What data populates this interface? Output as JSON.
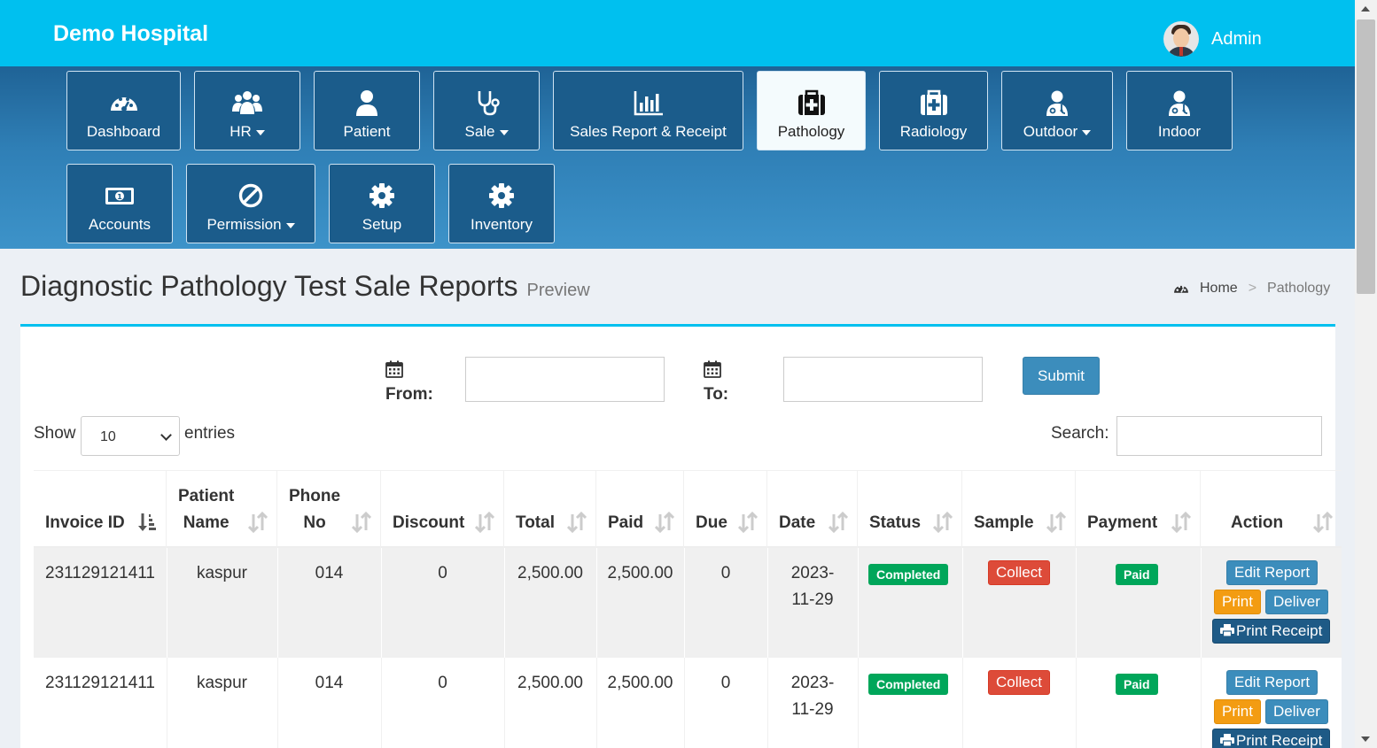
{
  "app": {
    "brand": "Demo Hospital",
    "user": "Admin"
  },
  "nav": {
    "dashboard": "Dashboard",
    "hr": "HR",
    "patient": "Patient",
    "sale": "Sale",
    "sales_report": "Sales Report & Receipt",
    "pathology": "Pathology",
    "radiology": "Radiology",
    "outdoor": "Outdoor",
    "indoor": "Indoor",
    "accounts": "Accounts",
    "permission": "Permission",
    "setup": "Setup",
    "inventory": "Inventory",
    "active": "Pathology"
  },
  "page": {
    "title": "Diagnostic Pathology Test Sale Reports",
    "subtitle": "Preview"
  },
  "breadcrumb": {
    "home": "Home",
    "separator": ">",
    "current": "Pathology"
  },
  "filter": {
    "from_label": "From:",
    "to_label": "To:",
    "from_value": "",
    "to_value": "",
    "submit": "Submit"
  },
  "table_controls": {
    "show": "Show",
    "entries": "entries",
    "page_size": "10",
    "search_label": "Search:",
    "search_value": ""
  },
  "table": {
    "headers": {
      "invoice_id": "Invoice ID",
      "patient_name_1": "Patient",
      "patient_name_2": "Name",
      "phone_1": "Phone",
      "phone_2": "No",
      "discount": "Discount",
      "total": "Total",
      "paid": "Paid",
      "due": "Due",
      "date": "Date",
      "status": "Status",
      "sample": "Sample",
      "payment": "Payment",
      "action": "Action"
    },
    "rows": [
      {
        "invoice_id": "231129121411",
        "patient_name": "kaspur",
        "phone": "014",
        "discount": "0",
        "total": "2,500.00",
        "paid": "2,500.00",
        "due": "0",
        "date_1": "2023-",
        "date_2": "11-29",
        "status": "Completed",
        "sample": "Collect",
        "payment": "Paid"
      },
      {
        "invoice_id": "231129121411",
        "patient_name": "kaspur",
        "phone": "014",
        "discount": "0",
        "total": "2,500.00",
        "paid": "2,500.00",
        "due": "0",
        "date_1": "2023-",
        "date_2": "11-29",
        "status": "Completed",
        "sample": "Collect",
        "payment": "Paid"
      }
    ],
    "actions": {
      "edit": "Edit Report",
      "print": "Print",
      "deliver": "Deliver",
      "print_receipt": "Print Receipt"
    }
  },
  "colors": {
    "header": "#00c0ef",
    "nav_tile": "#1b5c8b",
    "primary": "#3c8dbc",
    "success": "#00a65a",
    "danger": "#dd4b39",
    "warning": "#f39c12",
    "navy": "#1e5a86"
  },
  "icons": [
    "dashboard-icon",
    "users-icon",
    "user-icon",
    "stethoscope-icon",
    "bar-chart-icon",
    "medkit-icon",
    "hospital-icon",
    "doctor-icon",
    "money-icon",
    "ban-icon",
    "gear-icon",
    "calendar-icon",
    "sort-icon",
    "print-icon"
  ]
}
